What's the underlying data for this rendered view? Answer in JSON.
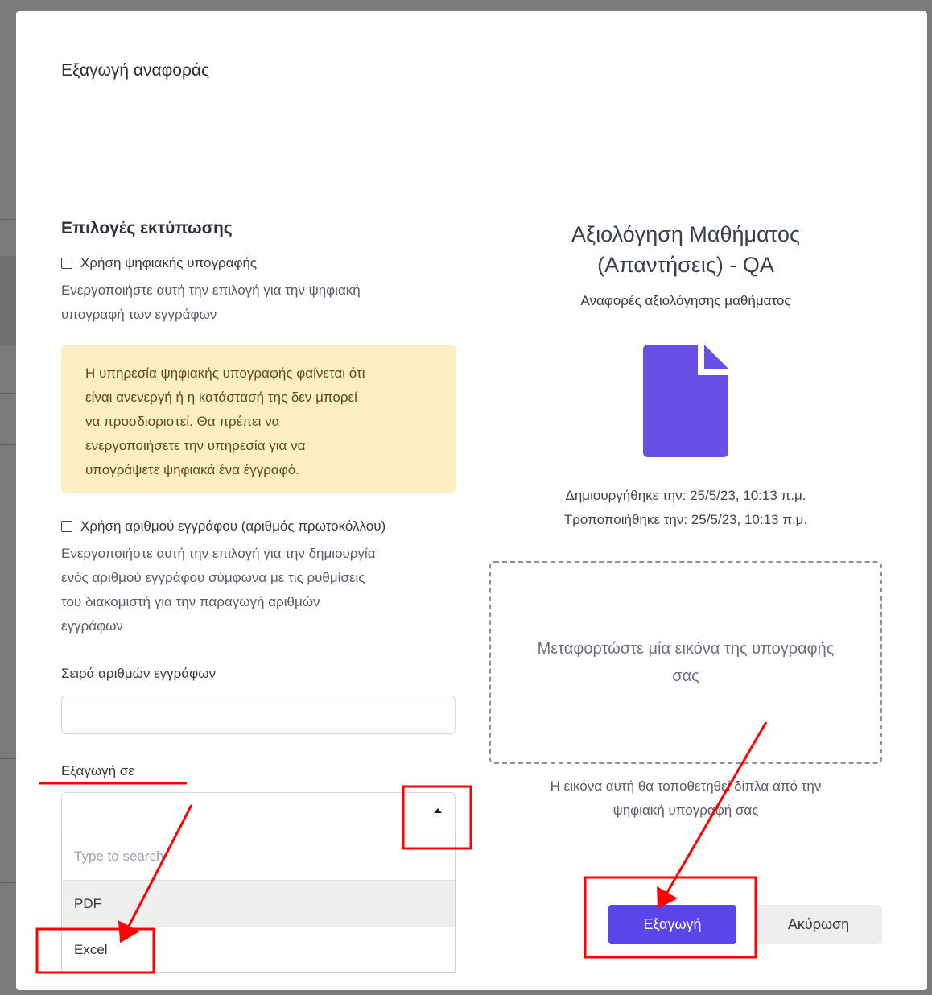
{
  "colors": {
    "accent": "#5b45ea",
    "file_icon": "#6a4ee8",
    "alert_bg": "#fdefc3",
    "annotation": "#ff0000"
  },
  "modal": {
    "title": "Εξαγωγή αναφοράς"
  },
  "print_options": {
    "title": "Επιλογές εκτύπωσης",
    "digital_signature": {
      "label": "Χρήση ψηφιακής υπογραφής",
      "checked": false,
      "help_line1": "Ενεργοποιήστε αυτή την επιλογή για την ψηφιακή",
      "help_line2": "υπογραφή των εγγράφων"
    },
    "alert": {
      "lines": [
        "Η υπηρεσία ψηφιακής υπογραφής φαίνεται ότι",
        "είναι ανενεργή ή η κατάστασή της δεν μπορεί",
        "να προσδιοριστεί. Θα πρέπει να",
        "ενεργοποιήσετε την υπηρεσία για να",
        "υπογράψετε ψηφιακά ένα έγγραφό."
      ]
    },
    "document_number": {
      "label": "Χρήση αριθμού εγγράφου (αριθμός πρωτοκόλλου)",
      "checked": false,
      "help_lines": [
        "Ενεργοποιήστε αυτή την επιλογή για την δημιουργία",
        "ενός αριθμού εγγράφου σύμφωνα με τις ρυθμίσεις",
        "του διακομιστή για την παραγωγή αριθμών",
        "εγγράφων"
      ]
    },
    "series": {
      "label": "Σειρά αριθμών εγγράφων",
      "value": ""
    },
    "export_to": {
      "label": "Εξαγωγή σε",
      "value": "",
      "search_placeholder": "Type to search",
      "options": [
        "PDF",
        "Excel"
      ]
    }
  },
  "document": {
    "title_line1": "Αξιολόγηση Μαθήματος",
    "title_line2": "(Απαντήσεις) - QA",
    "subtitle": "Αναφορές αξιολόγησης μαθήματος",
    "icon": "file-icon",
    "created": "Δημιουργήθηκε την: 25/5/23, 10:13 π.μ.",
    "modified": "Τροποποιήθηκε την: 25/5/23, 10:13 π.μ.",
    "upload_line1": "Μεταφορτώστε μία εικόνα της υπογραφής",
    "upload_line2": "σας",
    "upload_hint_line1": "Η εικόνα αυτή θα τοποθετηθεί δίπλα από την",
    "upload_hint_line2": "ψηφιακή υπογραφή σας"
  },
  "actions": {
    "export_label": "Εξαγωγή",
    "cancel_label": "Ακύρωση"
  }
}
